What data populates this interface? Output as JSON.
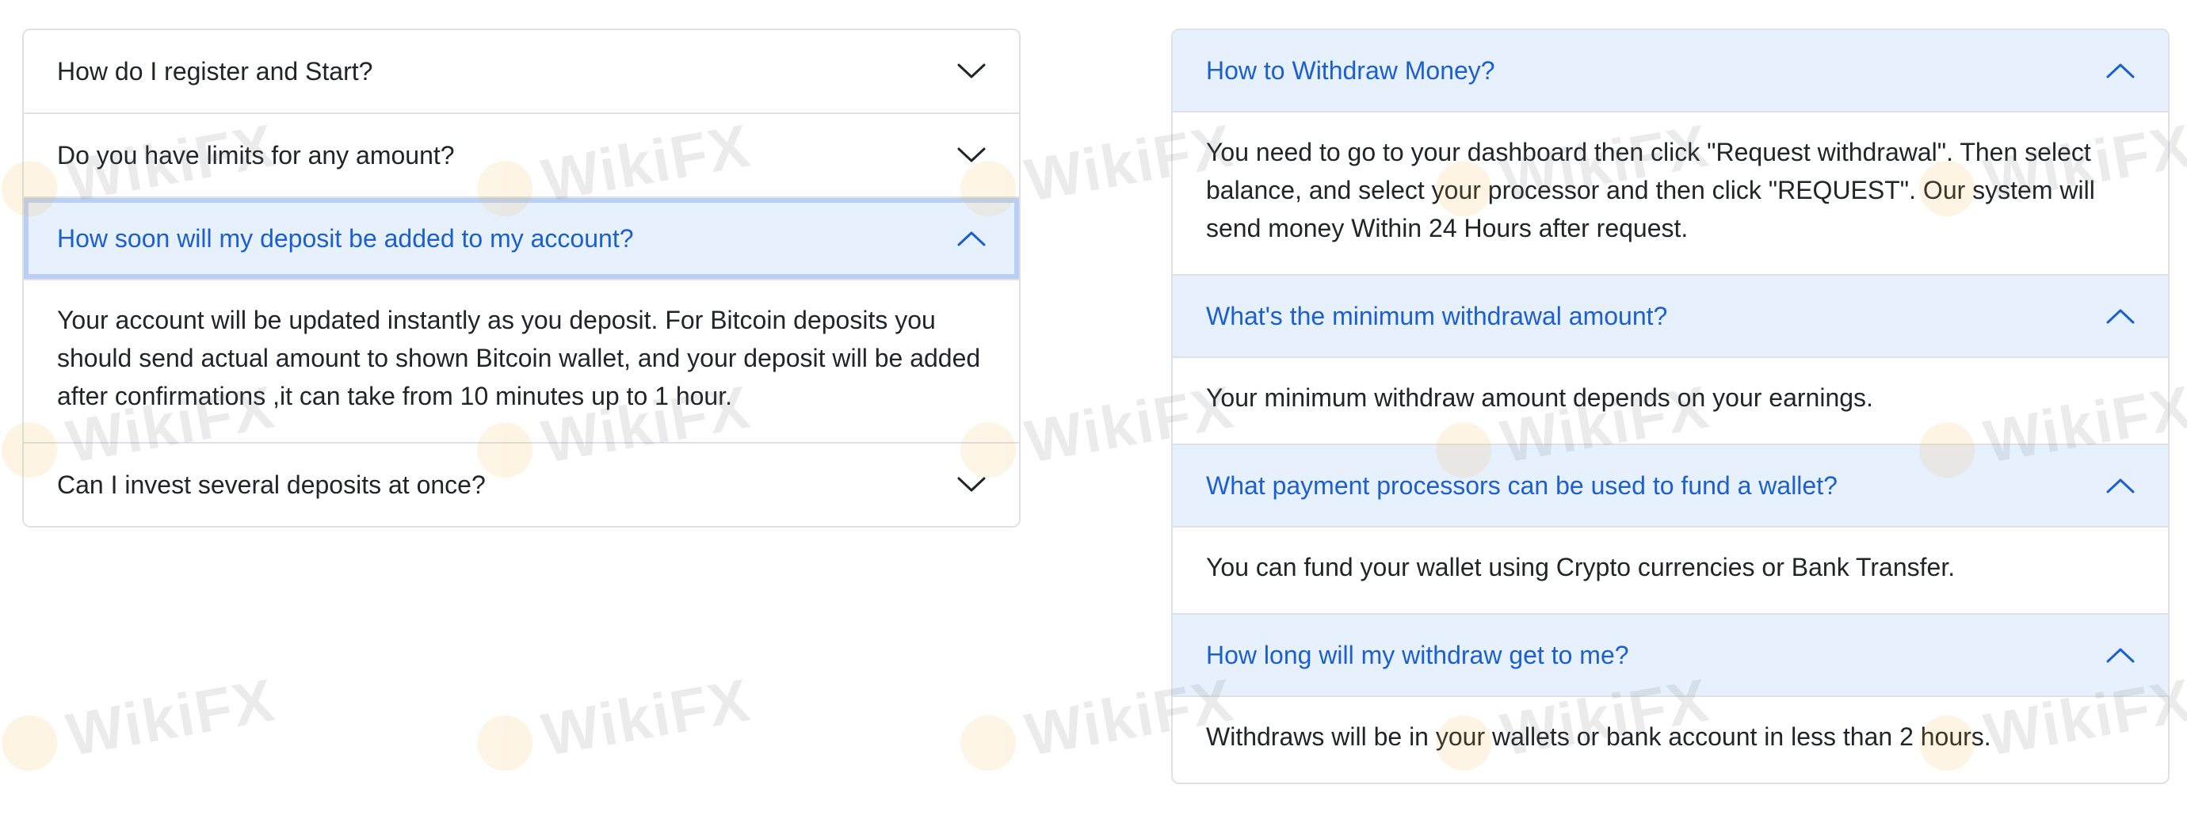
{
  "left_faq": [
    {
      "question": "How do I register and Start?",
      "open": false
    },
    {
      "question": "Do you have limits for any amount?",
      "open": false
    },
    {
      "question": "How soon will my deposit be added to my account?",
      "open": true,
      "answer": "Your account will be updated instantly as you deposit. For Bitcoin deposits you should send actual amount to shown Bitcoin wallet, and your deposit will be added after confirmations ,it can take from 10 minutes up to 1 hour."
    },
    {
      "question": "Can I invest several deposits at once?",
      "open": false
    }
  ],
  "right_faq": [
    {
      "question": "How to Withdraw Money?",
      "open": true,
      "answer": "You need to go to your dashboard then click \"Request withdrawal\". Then select balance, and select your processor and then click \"REQUEST\". Our system will send money Within 24 Hours after request."
    },
    {
      "question": "What's the minimum withdrawal amount?",
      "open": true,
      "answer": "Your minimum withdraw amount depends on your earnings."
    },
    {
      "question": "What payment processors can be used to fund a wallet?",
      "open": true,
      "answer": "You can fund your wallet using Crypto currencies or Bank Transfer."
    },
    {
      "question": "How long will my withdraw get to me?",
      "open": true,
      "answer": "Withdraws will be in your wallets or bank account in less than 2 hours."
    }
  ],
  "watermark": {
    "text": "WikiFX"
  },
  "colors": {
    "accent": "#1c5fcf",
    "open_header_bg": "#e7f0fd",
    "border": "#dee2e6",
    "text": "#212529"
  }
}
